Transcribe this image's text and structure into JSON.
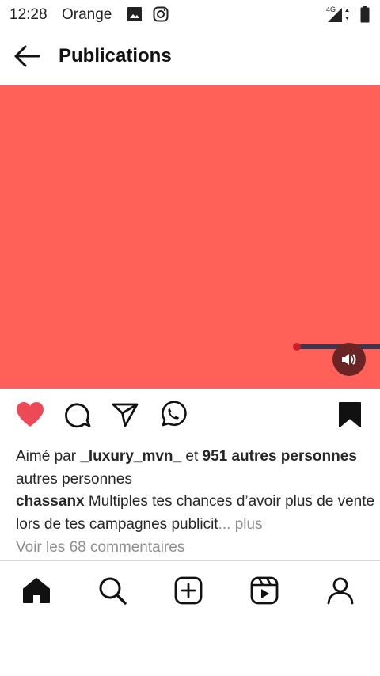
{
  "status_bar": {
    "time": "12:28",
    "carrier": "Orange",
    "network_label": "4G",
    "icons": [
      "image-icon",
      "instagram-icon",
      "signal-icon",
      "battery-icon"
    ]
  },
  "header": {
    "back_icon": "arrow-left-icon",
    "title": "Publications"
  },
  "post": {
    "media_color": "#ff6159",
    "sound_icon": "volume-icon",
    "actions": {
      "like_icon": "heart-filled-icon",
      "like_color": "#ed4956",
      "comment_icon": "comment-icon",
      "share_icon": "paper-plane-icon",
      "whatsapp_icon": "whatsapp-icon",
      "save_icon": "bookmark-filled-icon"
    },
    "likes": {
      "prefix": "Aimé par ",
      "user": "_luxury_mvn_",
      "middle": " et ",
      "count_bold": "951 autres personnes",
      "suffix": " autres personnes"
    },
    "caption": {
      "username": "chassanx",
      "text": " Multiples tes chances d’avoir plus de vente lors de tes campagnes publicit",
      "ellipsis": "...",
      "more": "plus"
    },
    "comments_link": "Voir les 68 commentaires"
  },
  "bottom_nav": {
    "items": [
      {
        "icon": "home-icon",
        "active": true
      },
      {
        "icon": "search-icon"
      },
      {
        "icon": "add-post-icon"
      },
      {
        "icon": "reels-icon"
      },
      {
        "icon": "profile-icon"
      }
    ]
  }
}
